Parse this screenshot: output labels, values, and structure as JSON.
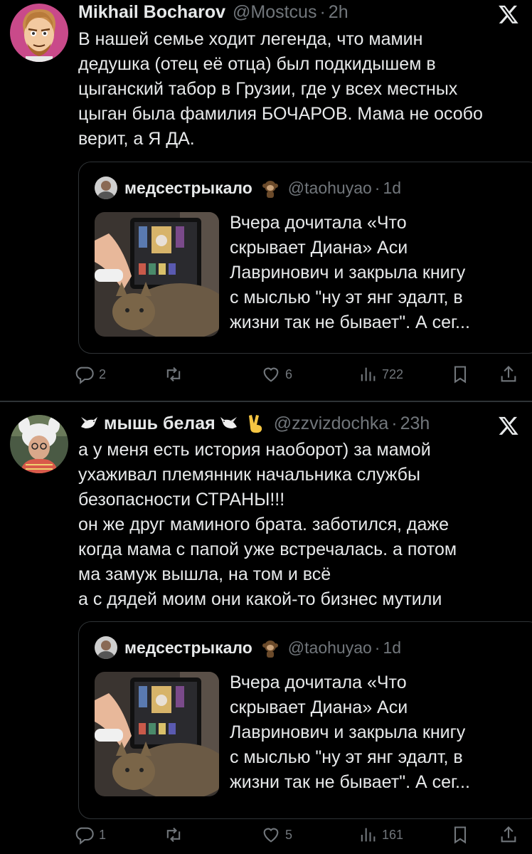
{
  "tweets": [
    {
      "author": "Mikhail Bocharov",
      "handle": "@Mostcus",
      "time": "2h",
      "lines": [
        "В нашей семье ходит легенда, что мамин",
        "дедушка (отец её отца) был подкидышем в",
        "цыганский табор в Грузии, где у всех местных",
        "цыган была фамилия БОЧАРОВ. Мама не особо",
        "верит, а Я ДА."
      ],
      "quote": {
        "author": "медсестрыкало",
        "handle": "@taohuyao",
        "time": "1d",
        "lines": [
          "Вчера дочитала «Что",
          "скрывает Диана» Аси",
          "Лавринович и закрыла книгу",
          "с мыслью \"ну эт янг эдалт, в",
          "жизни так не бывает\". А сег..."
        ]
      },
      "stats": {
        "replies": "2",
        "retweets": "",
        "likes": "6",
        "views": "722"
      }
    },
    {
      "author": "мышь белая",
      "handle": "@zzvizdochka",
      "time": "23h",
      "lines": [
        "а у меня есть история наоборот) за мамой",
        "ухаживал племянник начальника службы",
        "безопасности СТРАНЫ!!!",
        "он же друг маминого брата. заботился, даже",
        "когда мама с папой уже встречалась. а потом",
        "ма замуж вышла, на том и всё",
        "а с дядей моим они какой-то бизнес мутили"
      ],
      "quote": {
        "author": "медсестрыкало",
        "handle": "@taohuyao",
        "time": "1d",
        "lines": [
          "Вчера дочитала «Что",
          "скрывает Диана» Аси",
          "Лавринович и закрыла книгу",
          "с мыслью \"ну эт янг эдалт, в",
          "жизни так не бывает\". А сег..."
        ]
      },
      "stats": {
        "replies": "1",
        "retweets": "",
        "likes": "5",
        "views": "161"
      }
    }
  ],
  "separator": "·",
  "icons": [
    "x-logo-icon",
    "reply-icon",
    "retweet-icon",
    "like-icon",
    "views-icon",
    "bookmark-icon",
    "share-icon",
    "dove-icon",
    "peace-hand-icon",
    "monkey-emoji-icon"
  ],
  "colors": {
    "background": "#000000",
    "text": "#e7e9ea",
    "muted": "#71767b",
    "border": "#2f3336"
  }
}
